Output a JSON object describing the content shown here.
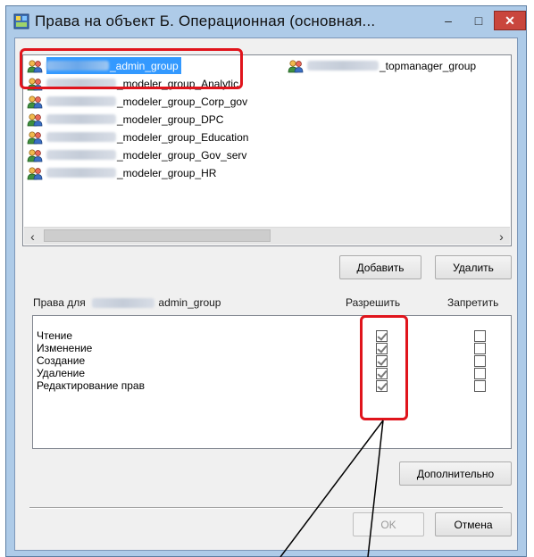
{
  "window": {
    "title": "Права на объект Б. Операционная (основная...",
    "minimize_glyph": "–",
    "maximize_glyph": "□",
    "close_glyph": "✕"
  },
  "groups": {
    "items": [
      {
        "suffix": "_admin_group",
        "selected": true
      },
      {
        "suffix": "_modeler_group_Analytic",
        "selected": false
      },
      {
        "suffix": "_modeler_group_Corp_gov",
        "selected": false
      },
      {
        "suffix": "_modeler_group_DPC",
        "selected": false
      },
      {
        "suffix": "_modeler_group_Education",
        "selected": false
      },
      {
        "suffix": "_modeler_group_Gov_serv",
        "selected": false
      },
      {
        "suffix": "_modeler_group_HR",
        "selected": false
      }
    ],
    "second_column": [
      {
        "suffix": "_topmanager_group",
        "selected": false
      }
    ],
    "icon": "group-users-icon"
  },
  "buttons": {
    "add": "Добавить",
    "remove": "Удалить",
    "advanced": "Дополнительно",
    "ok": "OK",
    "cancel": "Отмена"
  },
  "rights": {
    "label_prefix": "Права для",
    "label_suffix": "admin_group",
    "allow_header": "Разрешить",
    "deny_header": "Запретить",
    "rows": [
      {
        "name": "Чтение",
        "allow": true,
        "deny": false
      },
      {
        "name": "Изменение",
        "allow": true,
        "deny": false
      },
      {
        "name": "Создание",
        "allow": true,
        "deny": false
      },
      {
        "name": "Удаление",
        "allow": true,
        "deny": false
      },
      {
        "name": "Редактирование прав",
        "allow": true,
        "deny": false
      }
    ]
  },
  "colors": {
    "highlight": "#e0141c",
    "selection": "#3399ff",
    "title_bar": "#aecbe8",
    "close_button": "#c9463d"
  }
}
